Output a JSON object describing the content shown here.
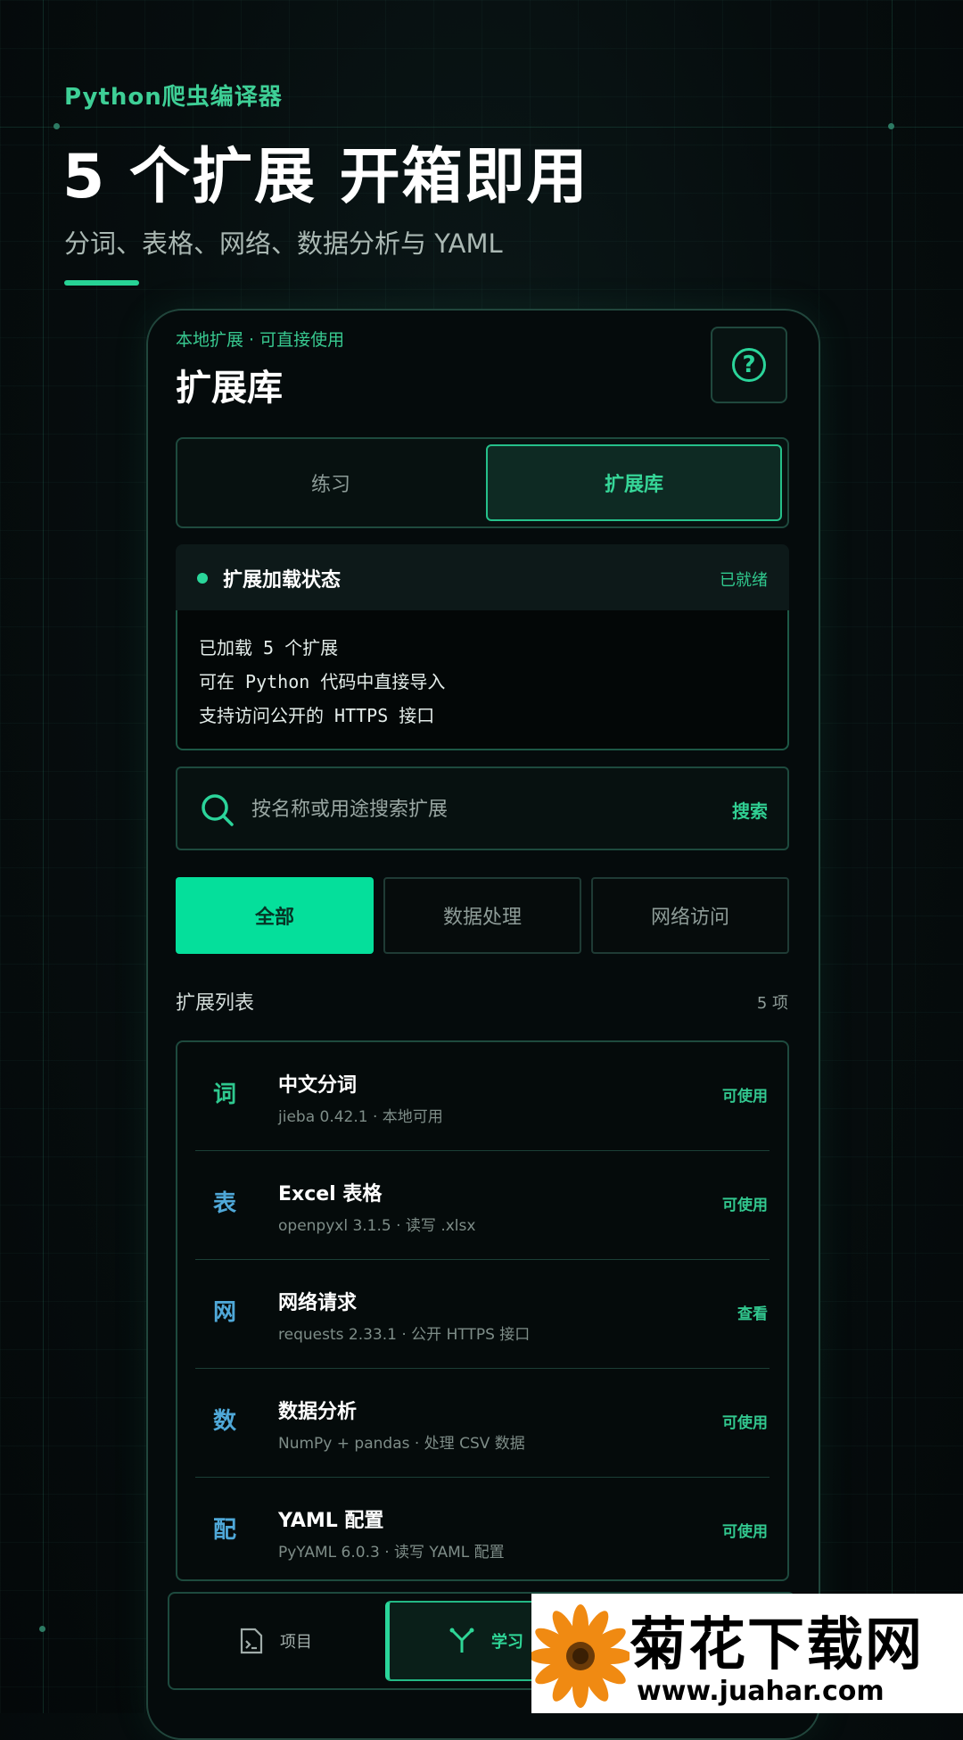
{
  "promo": {
    "app_name": "Python爬虫编译器",
    "headline": "5 个扩展 开箱即用",
    "subtitle": "分词、表格、网络、数据分析与 YAML"
  },
  "screen": {
    "section_label": "本地扩展 · 可直接使用",
    "title": "扩展库",
    "help_icon": "help-circle-icon"
  },
  "tabs": [
    {
      "label": "练习",
      "active": false
    },
    {
      "label": "扩展库",
      "active": true
    }
  ],
  "status": {
    "title": "扩展加载状态",
    "badge": "已就绪",
    "lines": [
      "已加载 5 个扩展",
      "可在 Python 代码中直接导入",
      "支持访问公开的 HTTPS 接口"
    ]
  },
  "search": {
    "placeholder": "按名称或用途搜索扩展",
    "button": "搜索"
  },
  "filters": [
    {
      "label": "全部",
      "active": true
    },
    {
      "label": "数据处理",
      "active": false
    },
    {
      "label": "网络访问",
      "active": false
    }
  ],
  "list": {
    "title": "扩展列表",
    "count": "5 项",
    "items": [
      {
        "icon": "词",
        "name": "中文分词",
        "meta": "jieba 0.42.1 · 本地可用",
        "action": "可使用",
        "color": "#2fc98f"
      },
      {
        "icon": "表",
        "name": "Excel 表格",
        "meta": "openpyxl 3.1.5 · 读写 .xlsx",
        "action": "可使用",
        "color": "#4fa8d8"
      },
      {
        "icon": "网",
        "name": "网络请求",
        "meta": "requests 2.33.1 · 公开 HTTPS 接口",
        "action": "查看",
        "color": "#4fa8d8"
      },
      {
        "icon": "数",
        "name": "数据分析",
        "meta": "NumPy + pandas · 处理 CSV 数据",
        "action": "可使用",
        "color": "#4fa8d8"
      },
      {
        "icon": "配",
        "name": "YAML 配置",
        "meta": "PyYAML 6.0.3 · 读写 YAML 配置",
        "action": "可使用",
        "color": "#4fa8d8"
      }
    ]
  },
  "bottom_nav": [
    {
      "label": "项目",
      "icon": "terminal-file-icon",
      "active": false
    },
    {
      "label": "学习",
      "icon": "branch-icon",
      "active": true
    }
  ],
  "watermark": {
    "text": "菊花下载网",
    "url": "www.juahar.com"
  },
  "colors": {
    "accent": "#05df9b",
    "accent_text": "#2fd697",
    "background": "#060d0e"
  }
}
